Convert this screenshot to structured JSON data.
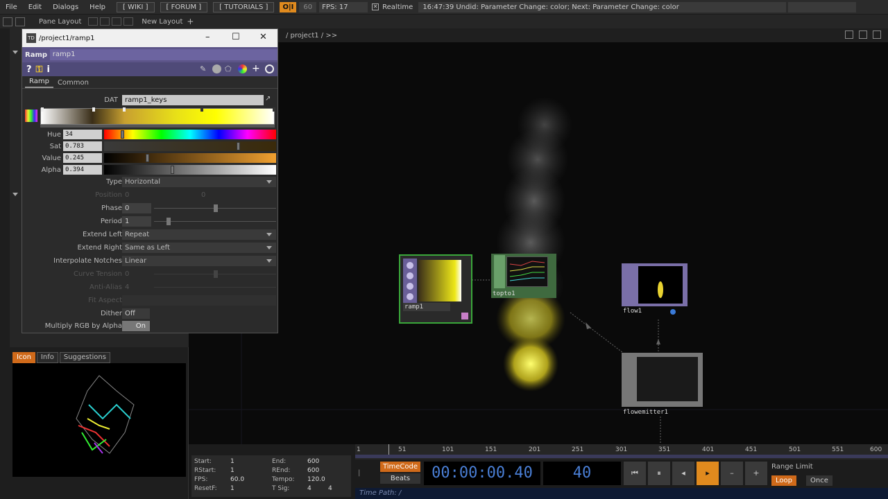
{
  "menubar": {
    "items": [
      "File",
      "Edit",
      "Dialogs",
      "Help"
    ],
    "wiki": "[ WIKI ]",
    "forum": "[ FORUM ]",
    "tutorials": "[ TUTORIALS ]",
    "oi": "O|I",
    "fps_value": "60",
    "fps_label": "FPS:  17",
    "realtime": "Realtime",
    "status": "16:47:39 Undid: Parameter Change: color; Next: Parameter Change: color"
  },
  "bar2": {
    "pane_layout": "Pane Layout",
    "new_layout": "New Layout"
  },
  "pathbar": {
    "path": "/ project1 / >>"
  },
  "param_window": {
    "title": "/project1/ramp1",
    "op_type": "Ramp",
    "op_name": "ramp1",
    "tabs": [
      "Ramp",
      "Common"
    ],
    "dat_label": "DAT",
    "dat_value": "ramp1_keys",
    "hue_label": "Hue",
    "hue_value": "34",
    "sat_label": "Sat",
    "sat_value": "0.783",
    "value_label": "Value",
    "value_value": "0.245",
    "alpha_label": "Alpha",
    "alpha_value": "0.394",
    "type_label": "Type",
    "type_value": "Horizontal",
    "position_label": "Position",
    "position_x": "0",
    "position_y": "0",
    "phase_label": "Phase",
    "phase_value": "0",
    "period_label": "Period",
    "period_value": "1",
    "extend_left_label": "Extend Left",
    "extend_left_value": "Repeat",
    "extend_right_label": "Extend Right",
    "extend_right_value": "Same as Left",
    "interpolate_label": "Interpolate Notches",
    "interpolate_value": "Linear",
    "curve_tension_label": "Curve Tension",
    "curve_tension_value": "0",
    "antialias_label": "Anti-Alias",
    "antialias_value": "4",
    "fit_aspect_label": "Fit Aspect",
    "dither_label": "Dither",
    "dither_value": "Off",
    "multiply_label": "Multiply RGB by Alpha",
    "multiply_value": "On"
  },
  "info_tabs": [
    "Icon",
    "Info",
    "Suggestions"
  ],
  "nodes": {
    "ramp": "ramp1",
    "topto": "topto1",
    "flow": "flow1",
    "emitter": "flowemitter1"
  },
  "timeline": {
    "ticks": [
      "1",
      "51",
      "101",
      "151",
      "201",
      "251",
      "301",
      "351",
      "401",
      "451",
      "501",
      "551",
      "600"
    ],
    "start_label": "Start:",
    "start": "1",
    "rstart_label": "RStart:",
    "rstart": "1",
    "fps_label": "FPS:",
    "fps": "60.0",
    "resetf_label": "ResetF:",
    "resetf": "1",
    "end_label": "End:",
    "end": "600",
    "rend_label": "REnd:",
    "rend": "600",
    "tempo_label": "Tempo:",
    "tempo": "120.0",
    "tsig_label": "T Sig:",
    "tsig_a": "4",
    "tsig_b": "4",
    "timecode_btn": "TimeCode",
    "beats_btn": "Beats",
    "timecode": "00:00:00.40",
    "frame": "40",
    "range_limit": "Range Limit",
    "loop": "Loop",
    "once": "Once",
    "time_path": "Time Path: /"
  },
  "colors": {
    "accent": "#e08a1e",
    "op_purple": "#5c5488",
    "timecode_blue": "#4a7fd6"
  }
}
